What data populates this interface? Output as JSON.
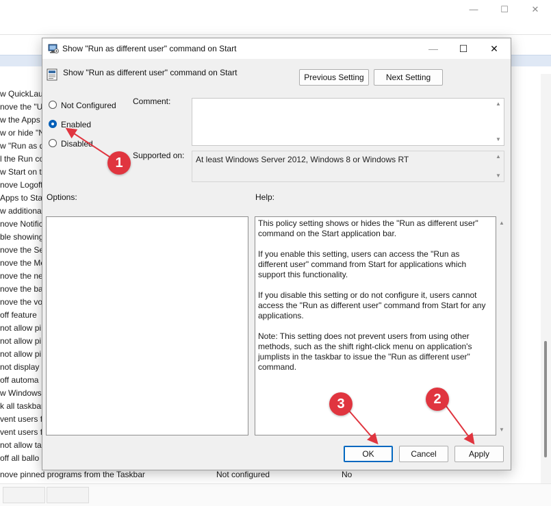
{
  "background_window": {
    "controls": {
      "minimize": "—",
      "maximize": "☐",
      "close": "✕"
    },
    "policy_list": [
      "w QuickLau",
      "nove the \"Ur",
      "w the Apps",
      "w or hide \"N",
      "w \"Run as d",
      "l the Run co",
      "w Start on th",
      "nove Logoff",
      "Apps to Star",
      "w additiona",
      "nove Notific",
      "ble showing",
      "nove the Sec",
      "nove the Me",
      "nove the net",
      "nove the bat",
      "nove the vol",
      "off feature",
      "not allow pi",
      "not allow pi",
      "not allow pi",
      "not display c",
      "off automa",
      "w Windows",
      "k all taskbar",
      "vent users fr",
      "vent users fr",
      "not allow tas",
      "off all ballo"
    ],
    "last_row": {
      "name": "nove pinned programs from the Taskbar",
      "state": "Not configured",
      "comment": "No"
    }
  },
  "dialog": {
    "title": "Show \"Run as different user\" command on Start",
    "controls": {
      "minimize": "—",
      "maximize": "☐",
      "close": "✕"
    },
    "heading": "Show \"Run as different user\" command on Start",
    "previous_setting": "Previous Setting",
    "next_setting": "Next Setting",
    "radios": [
      {
        "label": "Not Configured",
        "checked": false
      },
      {
        "label": "Enabled",
        "checked": true
      },
      {
        "label": "Disabled",
        "checked": false
      }
    ],
    "comment_label": "Comment:",
    "comment_value": "",
    "supported_label": "Supported on:",
    "supported_value": "At least Windows Server 2012, Windows 8 or Windows RT",
    "options_label": "Options:",
    "help_label": "Help:",
    "help_paragraphs": [
      "This policy setting shows or hides the \"Run as different user\" command on the Start application bar.",
      "If you enable this setting, users can access the \"Run as different user\" command from Start for applications which support this functionality.",
      "If you disable this setting or do not configure it, users cannot access the \"Run as different user\" command from Start for any applications.",
      "Note: This setting does not prevent users from using other methods, such as the shift right-click menu on application's jumplists in the taskbar to issue the \"Run as different user\" command."
    ],
    "ok": "OK",
    "cancel": "Cancel",
    "apply": "Apply"
  },
  "annotations": {
    "color": "#e0353f",
    "steps": [
      "1",
      "2",
      "3"
    ]
  }
}
